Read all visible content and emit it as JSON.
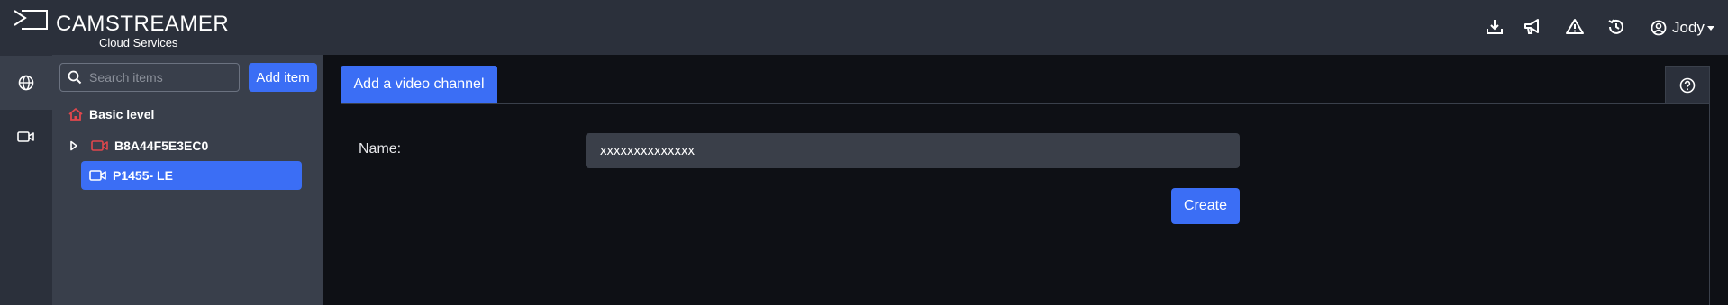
{
  "brand": {
    "name_prefix": "CAM",
    "name_suffix": "STREAMER",
    "subtitle": "Cloud Services"
  },
  "header": {
    "icons": [
      "download-icon",
      "megaphone-icon",
      "warning-icon",
      "history-icon"
    ],
    "user": {
      "name": "Jody",
      "icon": "user-circle-icon"
    }
  },
  "rail": {
    "items": [
      {
        "icon": "globe-icon",
        "active": true
      },
      {
        "icon": "camera-icon",
        "active": false
      }
    ]
  },
  "tree": {
    "search_placeholder": "Search items",
    "add_label": "Add item",
    "items": [
      {
        "label": "Basic level",
        "icon": "home-icon"
      },
      {
        "label": "B8A44F5E3EC0",
        "icon": "camera-icon",
        "expandable": true
      },
      {
        "label": "P1455- LE",
        "icon": "camera-icon",
        "selected": true
      }
    ]
  },
  "main": {
    "tab_label": "Add a video channel",
    "help_icon": "help-icon",
    "form": {
      "name_label": "Name:",
      "name_value": "xxxxxxxxxxxxxx",
      "create_label": "Create"
    }
  },
  "colors": {
    "accent": "#3b6ef5",
    "topbar": "#2b303b",
    "panel": "#393f4b",
    "background": "#0e1015",
    "icon_red": "#e0474c"
  }
}
